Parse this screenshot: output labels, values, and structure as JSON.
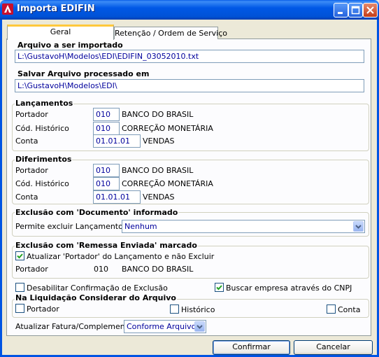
{
  "window": {
    "title": "Importa EDIFIN"
  },
  "tabs": [
    {
      "label": "Geral",
      "active": true
    },
    {
      "label": "Retenção / Ordem de Serviço",
      "active": false
    }
  ],
  "import_file": {
    "title": "Arquivo a ser importado",
    "value": "L:\\GustavoH\\Modelos\\EDI\\EDIFIN_03052010.txt"
  },
  "save_file": {
    "title": "Salvar Arquivo processado em",
    "value": "L:\\GustavoH\\Modelos\\EDI\\"
  },
  "lancamentos": {
    "title": "Lançamentos",
    "portador": {
      "label": "Portador",
      "code": "010",
      "desc": "BANCO DO BRASIL"
    },
    "historico": {
      "label": "Cód. Histórico",
      "code": "010",
      "desc": "CORREÇÃO MONETÁRIA"
    },
    "conta": {
      "label": "Conta",
      "code": "01.01.01",
      "desc": "VENDAS"
    }
  },
  "diferimentos": {
    "title": "Diferimentos",
    "portador": {
      "label": "Portador",
      "code": "010",
      "desc": "BANCO DO BRASIL"
    },
    "historico": {
      "label": "Cód. Histórico",
      "code": "010",
      "desc": "CORREÇÃO MONETÁRIA"
    },
    "conta": {
      "label": "Conta",
      "code": "01.01.01",
      "desc": "VENDAS"
    }
  },
  "exclusao_documento": {
    "title": "Exclusão com 'Documento' informado",
    "label": "Permite excluir Lançamentos",
    "value": "Nenhum"
  },
  "exclusao_remessa": {
    "title": "Exclusão com 'Remessa Enviada' marcado",
    "checkbox_label": "Atualizar 'Portador' do Lançamento e não Excluir",
    "checked": true,
    "portador_label": "Portador",
    "portador_code": "010",
    "portador_desc": "BANCO DO BRASIL"
  },
  "options": {
    "disable_confirm": {
      "label": "Desabilitar Confirmação de Exclusão",
      "checked": false
    },
    "search_cnpj": {
      "label": "Buscar empresa através do CNPJ",
      "checked": true
    }
  },
  "liquidacao": {
    "title": "Na Liquidação Considerar do Arquivo",
    "portador": {
      "label": "Portador",
      "checked": false
    },
    "historico": {
      "label": "Histórico",
      "checked": false
    },
    "conta": {
      "label": "Conta",
      "checked": false
    }
  },
  "fatura": {
    "label": "Atualizar Fatura/Complemento",
    "value": "Conforme Arquivo"
  },
  "buttons": {
    "confirm": "Confirmar",
    "cancel": "Cancelar"
  },
  "colors": {
    "titlebar": "#0054E3",
    "field_text": "#00009C",
    "tab_highlight": "#FFC83C",
    "face": "#ECE9D8"
  }
}
